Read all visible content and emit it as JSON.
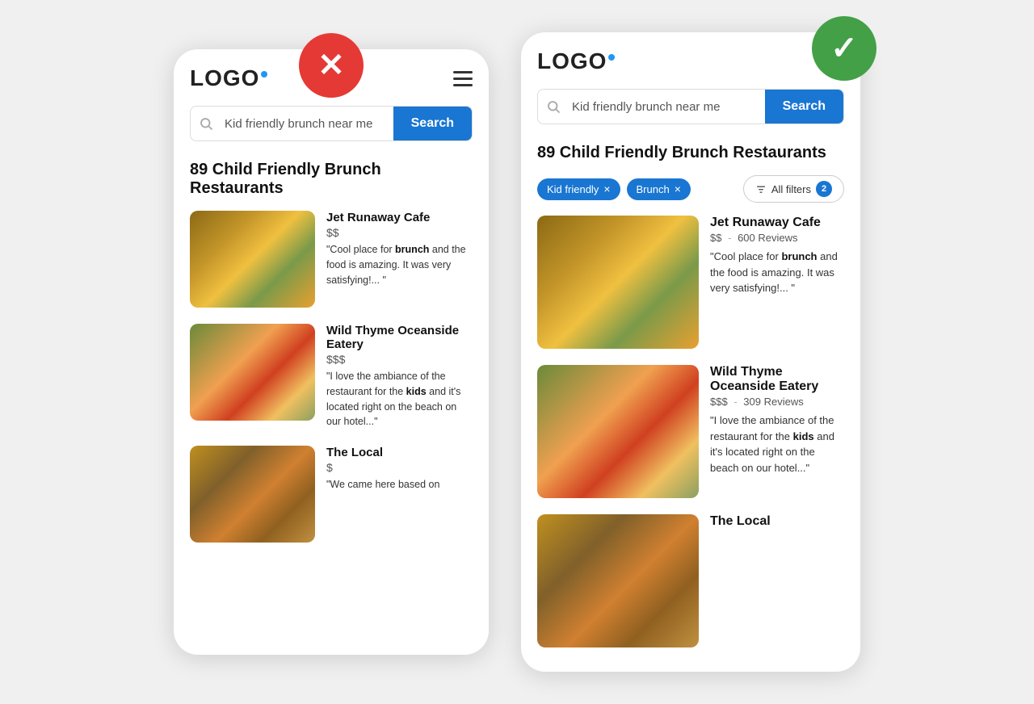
{
  "left_phone": {
    "logo": "LOGO",
    "badge": "✕",
    "badge_type": "wrong",
    "search": {
      "value": "Kid friendly brunch near me",
      "placeholder": "Kid friendly brunch near me",
      "button_label": "Search"
    },
    "results_title": "89 Child Friendly Brunch Restaurants",
    "restaurants": [
      {
        "name": "Jet Runaway Cafe",
        "price": "$$",
        "review_prefix": "\"Cool place for ",
        "review_bold": "brunch",
        "review_suffix": " and the food is amazing. It was very satisfying!... \"",
        "img_class": "food-img-1"
      },
      {
        "name": "Wild Thyme Oceanside Eatery",
        "price": "$$$",
        "review_prefix": "\"I love the ambiance of the restaurant for the ",
        "review_bold": "kids",
        "review_suffix": " and it's located right on the beach on our hotel...\"",
        "img_class": "food-img-2"
      },
      {
        "name": "The Local",
        "price": "$",
        "review_prefix": "\"We came here based on",
        "review_bold": "",
        "review_suffix": "",
        "img_class": "food-img-3"
      }
    ]
  },
  "right_phone": {
    "logo": "LOGO",
    "badge": "✓",
    "badge_type": "right",
    "search": {
      "value": "Kid friendly brunch near me",
      "placeholder": "Kid friendly brunch near me",
      "button_label": "Search"
    },
    "results_title": "89 Child Friendly Brunch Restaurants",
    "filters": [
      {
        "label": "Kid friendly",
        "id": "filter-kid-friendly"
      },
      {
        "label": "Brunch",
        "id": "filter-brunch"
      }
    ],
    "all_filters_label": "All filters",
    "all_filters_count": "2",
    "restaurants": [
      {
        "name": "Jet Runaway Cafe",
        "price": "$$",
        "reviews": "600 Reviews",
        "review_prefix": "\"Cool place for ",
        "review_bold": "brunch",
        "review_suffix": " and the food is amazing. It was very satisfying!... \"",
        "img_class": "food-img-1"
      },
      {
        "name": "Wild Thyme Oceanside Eatery",
        "price": "$$$",
        "reviews": "309 Reviews",
        "review_prefix": "\"I love the ambiance of the restaurant for the ",
        "review_bold": "kids",
        "review_suffix": " and it's located right on the beach on our hotel...\"",
        "img_class": "food-img-2"
      },
      {
        "name": "The Local",
        "price": "$",
        "reviews": "",
        "review_prefix": "",
        "review_bold": "",
        "review_suffix": "",
        "img_class": "food-img-3"
      }
    ]
  }
}
